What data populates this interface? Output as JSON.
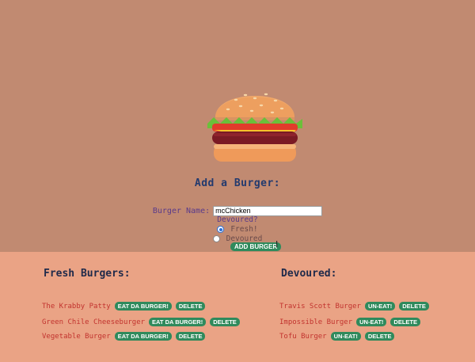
{
  "form": {
    "title": "Add a Burger:",
    "name_label": "Burger Name:",
    "name_value": "mcChicken",
    "devoured_label": "Devoured?",
    "option_fresh": "Fresh!",
    "option_devoured": "Devoured",
    "selected_option": "Fresh!",
    "add_button": "ADD BURGER"
  },
  "fresh": {
    "title": "Fresh Burgers:",
    "eat_label": "EAT DA BURGER!",
    "delete_label": "DELETE",
    "items": [
      "The Krabby Patty",
      "Green Chile Cheeseburger",
      "Vegetable Burger"
    ]
  },
  "devoured": {
    "title": "Devoured:",
    "uneat_label": "UN-EAT!",
    "delete_label": "DELETE",
    "items": [
      "Travis Scott Burger",
      "Impossible Burger",
      "Tofu Burger"
    ]
  },
  "colors": {
    "top_bg": "#c18a71",
    "bottom_bg": "#eaa385",
    "button": "#2f8a5c",
    "item_text": "#c2332e"
  }
}
